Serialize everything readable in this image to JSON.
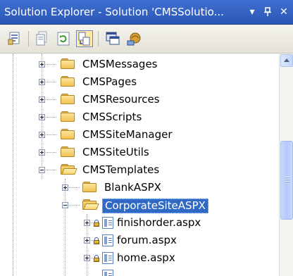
{
  "title": {
    "text": "Solution Explorer - Solution 'CMSSolutio...",
    "dropdown_glyph": "▾",
    "pin_glyph": "ᚁ",
    "close_glyph": "✕"
  },
  "toolbar": {
    "buttons": [
      {
        "name": "properties-icon"
      },
      {
        "name": "show-all-files-icon"
      },
      {
        "name": "refresh-icon"
      },
      {
        "name": "nest-related-files-icon"
      },
      {
        "name": "view-designer-icon"
      },
      {
        "name": "copy-website-icon"
      }
    ]
  },
  "tree": {
    "items": [
      {
        "label": "CMSMessages",
        "type": "folder",
        "expander": "plus"
      },
      {
        "label": "CMSPages",
        "type": "folder",
        "expander": "plus"
      },
      {
        "label": "CMSResources",
        "type": "folder",
        "expander": "plus"
      },
      {
        "label": "CMSScripts",
        "type": "folder",
        "expander": "plus"
      },
      {
        "label": "CMSSiteManager",
        "type": "folder",
        "expander": "plus"
      },
      {
        "label": "CMSSiteUtils",
        "type": "folder",
        "expander": "plus"
      },
      {
        "label": "CMSTemplates",
        "type": "folder-open",
        "expander": "minus"
      },
      {
        "label": "BlankASPX",
        "type": "folder",
        "expander": "plus"
      },
      {
        "label": "CorporateSiteASPX",
        "type": "folder-open",
        "expander": "minus",
        "selected": true
      },
      {
        "label": "finishorder.aspx",
        "type": "file",
        "expander": "plus"
      },
      {
        "label": "forum.aspx",
        "type": "file",
        "expander": "plus"
      },
      {
        "label": "home.aspx",
        "type": "file",
        "expander": "plus"
      }
    ]
  },
  "colors": {
    "titlebar": "#2a57b8",
    "selection": "#316ac5"
  }
}
